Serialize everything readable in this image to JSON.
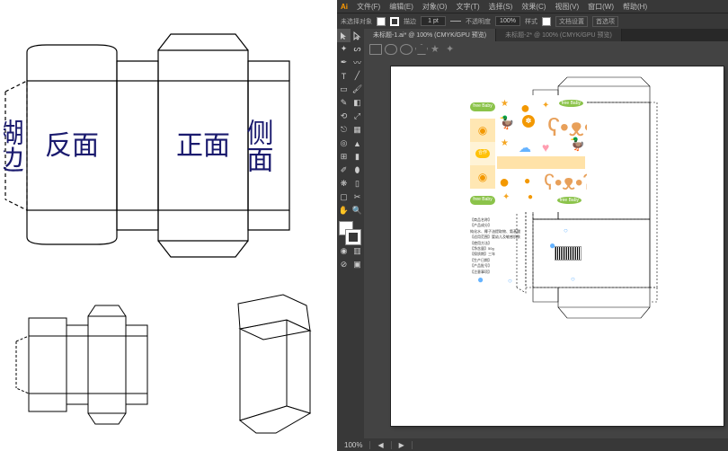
{
  "leftDiagram": {
    "labels": {
      "glueEdge": "糊边",
      "backFace": "反面",
      "frontFace": "正面",
      "sideFace": "侧面"
    }
  },
  "illustrator": {
    "menu": [
      "文件(F)",
      "编辑(E)",
      "对象(O)",
      "文字(T)",
      "选择(S)",
      "效果(C)",
      "视图(V)",
      "窗口(W)",
      "帮助(H)"
    ],
    "controlBar": {
      "noSelectionLabel": "未选择对象",
      "strokeLabel": "描边",
      "strokeValue": "1 pt",
      "opacityLabel": "不透明度",
      "opacityValue": "100%",
      "styleLabel": "样式",
      "docSetupLabel": "文档设置",
      "prefLabel": "首选项"
    },
    "tabs": [
      {
        "title": "未标题-1.ai* @ 100% (CMYK/GPU 预览)",
        "active": true
      },
      {
        "title": "未标题-2* @ 100% (CMYK/GPU 预览)",
        "active": false
      }
    ],
    "statusBar": {
      "zoom": "100%"
    },
    "design": {
      "brandBadge": "free\nBaby",
      "sideBadge": "合作",
      "productInfo": [
        "【商品名称】",
        "【产品成分】",
        "纯化水、椰子油提取物、氨基酸",
        "【适用范围】婴幼儿及敏感肌肤",
        "【使用方法】",
        "【净含量】50g",
        "【保质期】三年",
        "【生产日期】",
        "【产品批号】",
        "【注意事项】"
      ]
    }
  }
}
